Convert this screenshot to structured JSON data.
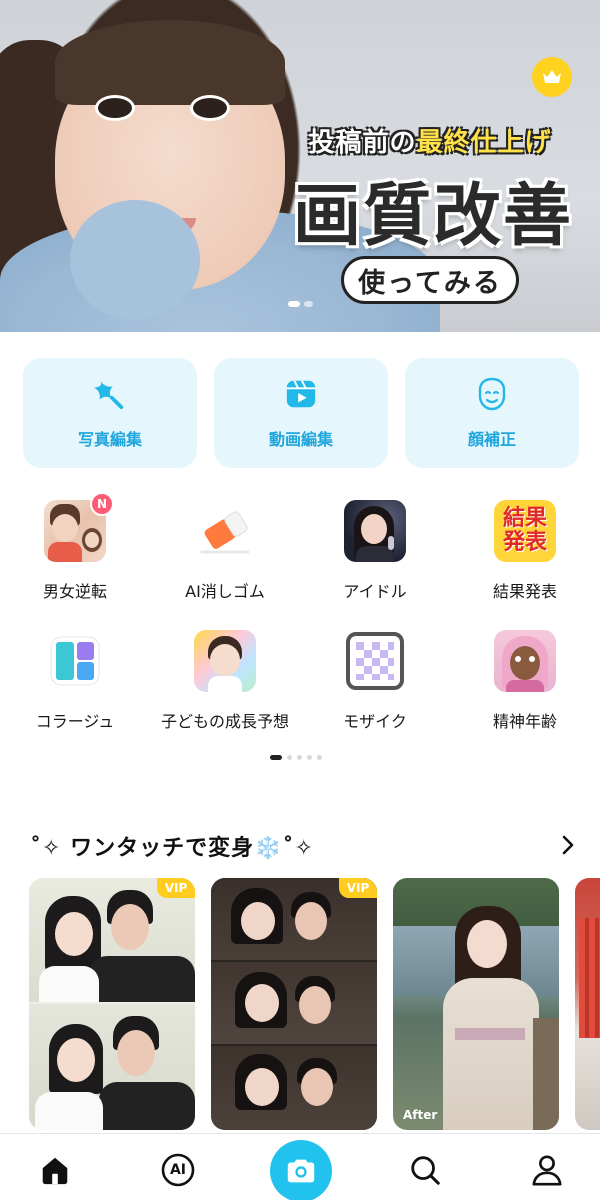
{
  "banner": {
    "subtitle_prefix": "投稿前の",
    "subtitle_highlight": "最終仕上げ",
    "title": "画質改善",
    "cta_label": "使ってみる",
    "page_count": 2,
    "active_page": 1
  },
  "main_features": [
    {
      "label": "写真編集",
      "icon": "star-sparkle-icon"
    },
    {
      "label": "動画編集",
      "icon": "video-play-icon"
    },
    {
      "label": "顔補正",
      "icon": "smile-face-icon"
    }
  ],
  "tools": [
    {
      "label": "男女逆転",
      "badge": "N"
    },
    {
      "label": "AI消しゴム"
    },
    {
      "label": "アイドル"
    },
    {
      "label": "結果発表",
      "thumb_text": "結果発表"
    },
    {
      "label": "コラージュ"
    },
    {
      "label": "子どもの成長予想"
    },
    {
      "label": "モザイク"
    },
    {
      "label": "精神年齢"
    }
  ],
  "tools_pager": {
    "pages": 5,
    "active": 1
  },
  "section": {
    "title": "˚✧ ワンタッチで変身❄️˚✧",
    "items": [
      {
        "badge": "VIP"
      },
      {
        "badge": "VIP"
      },
      {
        "caption": "After"
      },
      {}
    ]
  },
  "nav": {
    "items": [
      "home-icon",
      "ai-icon",
      "camera-icon",
      "search-icon",
      "profile-icon"
    ],
    "ai_label": "AI"
  },
  "colors": {
    "accent": "#22c2ee",
    "card_bg": "#e5f6fd",
    "card_text": "#1fa6dc",
    "vip": "#ffcc1f",
    "new_badge": "#ff5d75"
  }
}
